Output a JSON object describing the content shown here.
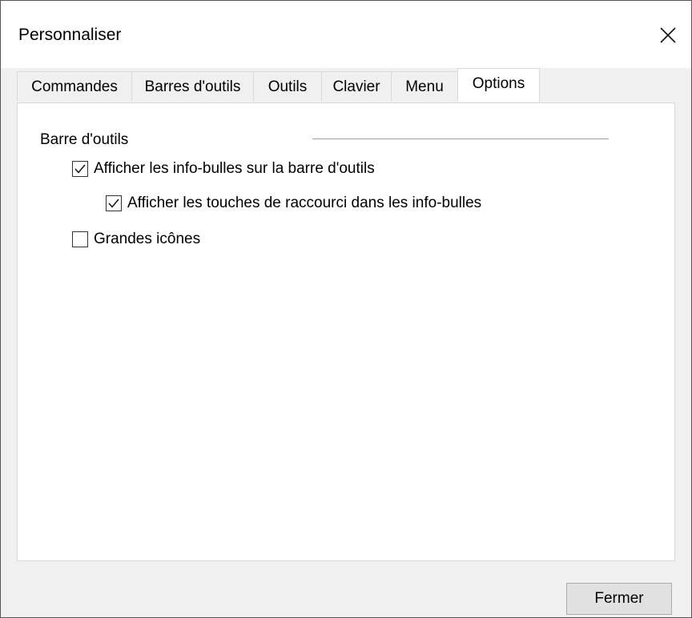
{
  "dialog": {
    "title": "Personnaliser",
    "close_icon": "close-icon"
  },
  "tabs": [
    {
      "label": "Commandes",
      "active": false
    },
    {
      "label": "Barres d'outils",
      "active": false
    },
    {
      "label": "Outils",
      "active": false
    },
    {
      "label": "Clavier",
      "active": false
    },
    {
      "label": "Menu",
      "active": false
    },
    {
      "label": "Options",
      "active": true
    }
  ],
  "options": {
    "group_label": "Barre d'outils",
    "checkboxes": [
      {
        "label": "Afficher les info-bulles sur la barre d'outils",
        "checked": true
      },
      {
        "label": "Afficher les touches de raccourci dans les info-bulles",
        "checked": true
      },
      {
        "label": "Grandes icônes",
        "checked": false
      }
    ]
  },
  "footer": {
    "close_label": "Fermer"
  }
}
